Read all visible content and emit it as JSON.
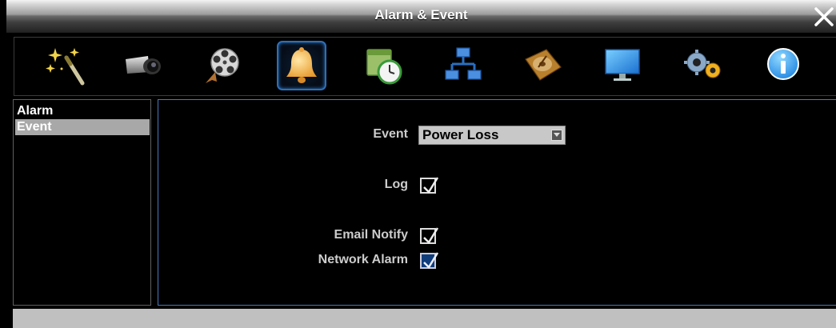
{
  "window": {
    "title": "Alarm & Event",
    "close_icon": "close-icon"
  },
  "toolbar": {
    "items": [
      {
        "icon": "wizard-wand-icon",
        "selected": false
      },
      {
        "icon": "camera-icon",
        "selected": false
      },
      {
        "icon": "film-reel-icon",
        "selected": false
      },
      {
        "icon": "bell-alarm-icon",
        "selected": true
      },
      {
        "icon": "schedule-clock-icon",
        "selected": false
      },
      {
        "icon": "network-icon",
        "selected": false
      },
      {
        "icon": "hard-disk-icon",
        "selected": false
      },
      {
        "icon": "monitor-icon",
        "selected": false
      },
      {
        "icon": "settings-gears-icon",
        "selected": false
      },
      {
        "icon": "info-icon",
        "selected": false
      }
    ]
  },
  "sidebar": {
    "items": [
      {
        "label": "Alarm",
        "active": false
      },
      {
        "label": "Event",
        "active": true
      }
    ]
  },
  "form": {
    "event": {
      "label": "Event",
      "value": "Power Loss"
    },
    "log": {
      "label": "Log",
      "checked": true
    },
    "email_notify": {
      "label": "Email Notify",
      "checked": true
    },
    "network_alarm": {
      "label": "Network Alarm",
      "checked": true
    }
  },
  "colors": {
    "selected_border": "#2e6fb8",
    "panel_border": "#4a78b8",
    "active_item_bg": "#a8a8a8",
    "network_alarm_check_bg": "#0f3d7c"
  }
}
